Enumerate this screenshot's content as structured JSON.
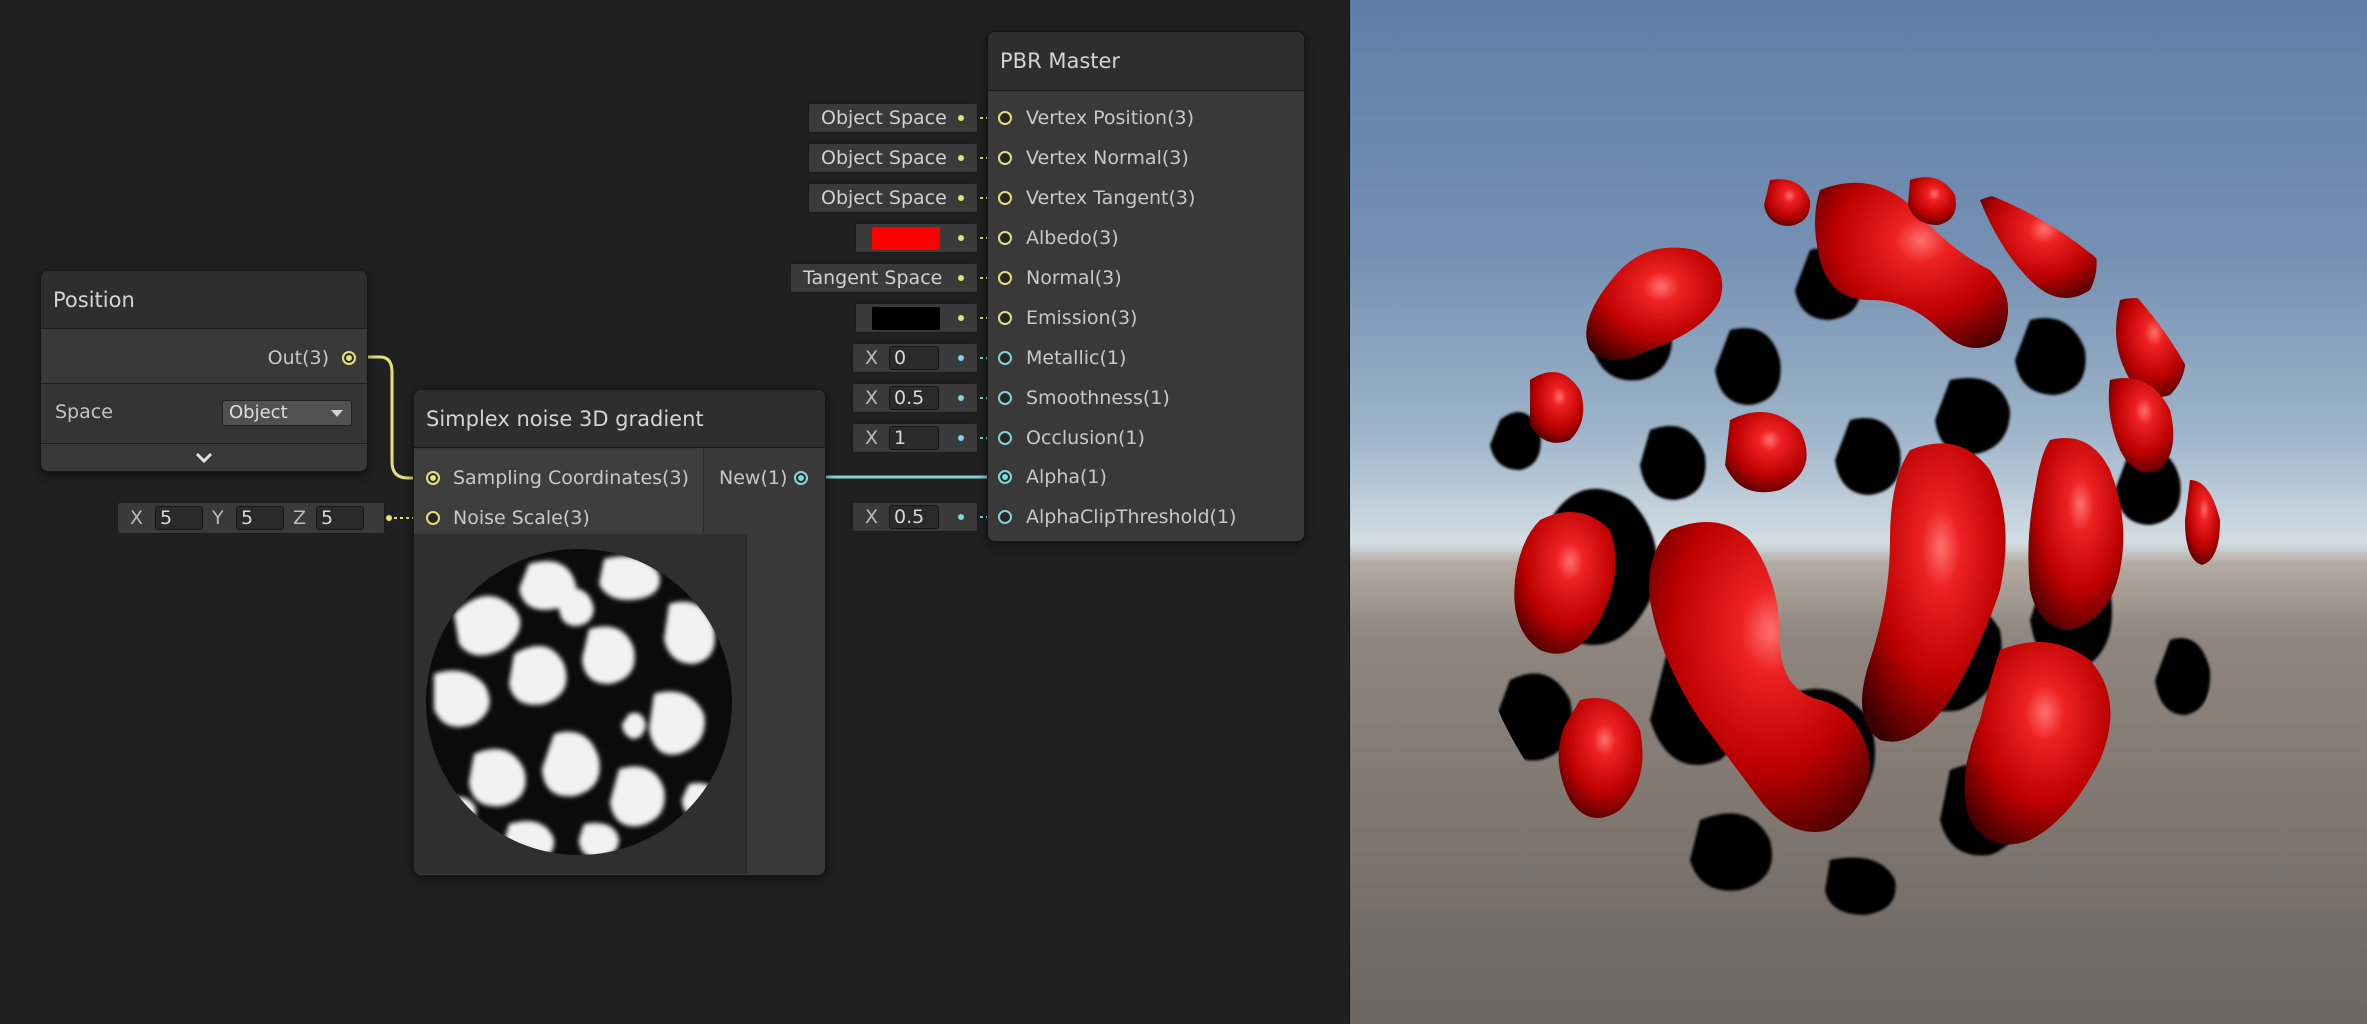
{
  "position_node": {
    "title": "Position",
    "output_label": "Out(3)",
    "space_label": "Space",
    "space_value": "Object",
    "expand_icon": "chevron-down-icon"
  },
  "noise_node": {
    "title": "Simplex noise 3D gradient",
    "inputs": [
      "Sampling Coordinates(3)",
      "Noise Scale(3)"
    ],
    "output_label": "New(1)"
  },
  "noise_scale": {
    "x_label": "X",
    "x_value": "5",
    "y_label": "Y",
    "y_value": "5",
    "z_label": "Z",
    "z_value": "5"
  },
  "master_node": {
    "title": "PBR Master",
    "ports": [
      "Vertex Position(3)",
      "Vertex Normal(3)",
      "Vertex Tangent(3)",
      "Albedo(3)",
      "Normal(3)",
      "Emission(3)",
      "Metallic(1)",
      "Smoothness(1)",
      "Occlusion(1)",
      "Alpha(1)",
      "AlphaClipThreshold(1)"
    ]
  },
  "master_inputs": {
    "vertex_position": "Object Space",
    "vertex_normal": "Object Space",
    "vertex_tangent": "Object Space",
    "albedo_color": "#ff0000",
    "normal": "Tangent Space",
    "emission_color": "#000000",
    "metallic_label": "X",
    "metallic_value": "0",
    "smoothness_label": "X",
    "smoothness_value": "0.5",
    "occlusion_label": "X",
    "occlusion_value": "1",
    "alpha_clip_label": "X",
    "alpha_clip_value": "0.5"
  },
  "colors": {
    "vector3_port": "#e3e07c",
    "vector1_port": "#7fd4dd",
    "albedo": "#ff0000"
  }
}
